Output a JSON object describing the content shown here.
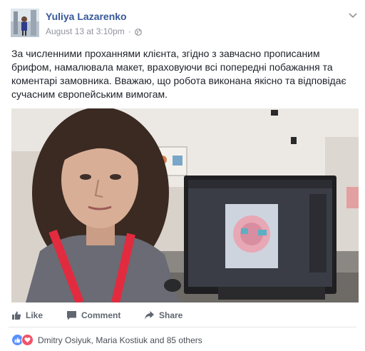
{
  "post": {
    "author": "Yuliya Lazarenko",
    "timestamp": "August 13 at 3:10pm",
    "separator": "·",
    "text": "За численними проханнями клієнта, згідно з завчасно прописаним брифом, намалювала макет, враховуючи всі попередні побажання та коментарі замовника. Вважаю, що робота виконана якісно та відповідає сучасним європейським вимогам.",
    "photo_icon": "photo-woman-at-monitor"
  },
  "actions": {
    "like_label": "Like",
    "comment_label": "Comment",
    "share_label": "Share"
  },
  "reactions": {
    "summary": "Dmitry Osiyuk, Maria Kostiuk and 85 others",
    "icons": [
      "like-reaction-icon",
      "love-reaction-icon"
    ]
  },
  "colors": {
    "author_link": "#365899",
    "meta": "#90949c",
    "action_text": "#606770",
    "like_reaction": "#5890ff",
    "love_reaction": "#f25268"
  }
}
